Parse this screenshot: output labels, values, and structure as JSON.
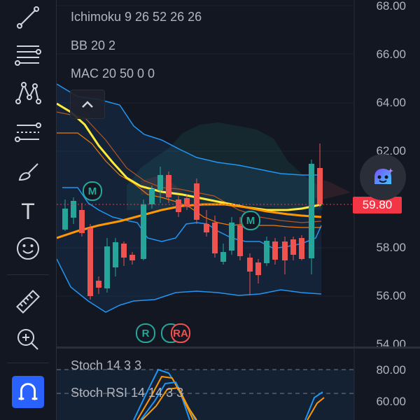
{
  "toolbar": {
    "tools": [
      {
        "name": "trend-line-tool",
        "icon": "trend-line-icon"
      },
      {
        "name": "horizontal-lines-tool",
        "icon": "lines-icon"
      },
      {
        "name": "pattern-tool",
        "icon": "pattern-icon"
      },
      {
        "name": "fib-tool",
        "icon": "fib-icon"
      },
      {
        "name": "brush-tool",
        "icon": "brush-icon"
      },
      {
        "name": "text-tool",
        "icon": "text-icon"
      },
      {
        "name": "emoji-tool",
        "icon": "smiley-icon"
      },
      {
        "name": "ruler-tool",
        "icon": "ruler-icon"
      },
      {
        "name": "zoom-tool",
        "icon": "zoom-in-icon"
      },
      {
        "name": "magnet-tool",
        "icon": "magnet-icon",
        "active": true
      }
    ],
    "text_tool_glyph": "T",
    "active_color": "#2962ff"
  },
  "legend": {
    "ichimoku": "Ichimoku 9 26 52 26 26",
    "bb": "BB 20 2",
    "mac": "MAC 20 50 0 0"
  },
  "price_axis": {
    "labels": [
      "68.00",
      "66.00",
      "64.00",
      "62.00",
      "58.00",
      "56.00",
      "54.00"
    ],
    "current_price": "59.80",
    "current_price_color": "#f23645"
  },
  "oscillator": {
    "stoch_label": "Stoch 14 3 3",
    "stoch_rsi_label": "Stoch RSI 14 14 3 3",
    "labels": [
      "80.00",
      "60.00"
    ]
  },
  "markers": {
    "m": "M",
    "r": "R",
    "ra": "RA"
  },
  "colors": {
    "background": "#131722",
    "bullish": "#26a69a",
    "bearish": "#ef5350",
    "bb_line": "#2196f3",
    "ma_fast": "#ffeb3b",
    "ma_slow": "#ff9800"
  }
}
